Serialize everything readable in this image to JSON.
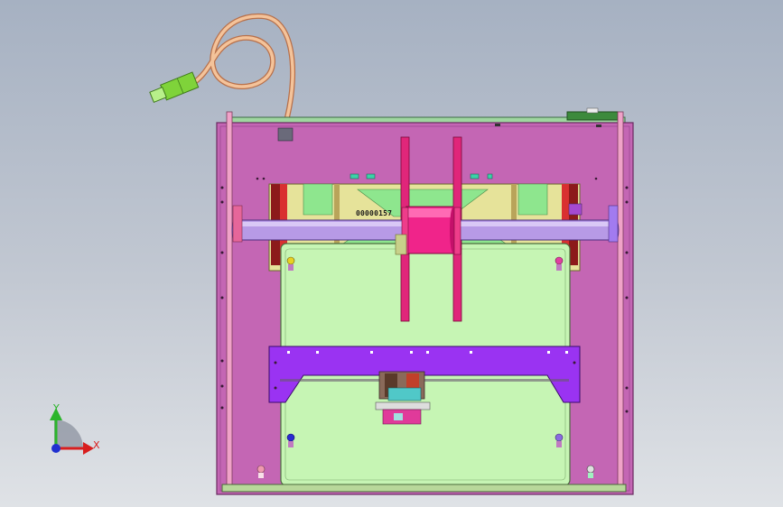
{
  "part_label": "00000157",
  "triad": {
    "y_label": "Y",
    "x_label": "X"
  },
  "colors": {
    "frame_magenta": "#c466b4",
    "frame_edge": "#6a2a60",
    "top_bar_green": "#9fd6a0",
    "window_yellow": "#e6e39a",
    "window_green": "#8ee68e",
    "bed_green": "#c6f5b4",
    "purple_bar": "#9a33f2",
    "lavender_rod": "#b79ae6",
    "spool_pink": "#e0267a",
    "cable_orange": "#f0b78a",
    "usb_green": "#7fd33a",
    "axis_x": "#d81e1e",
    "axis_y": "#2bb52b",
    "axis_origin": "#2030d0"
  }
}
